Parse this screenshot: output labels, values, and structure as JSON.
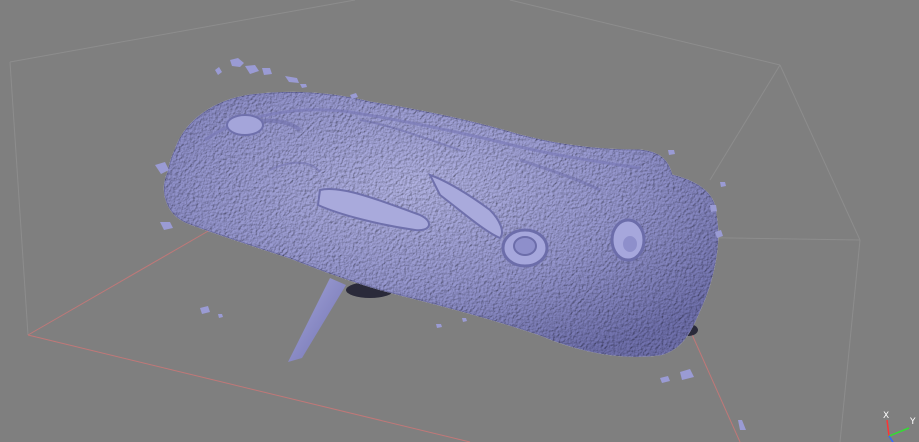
{
  "viewport": {
    "background": "#7f7f7f",
    "mesh_color": "#9a9bd4",
    "bbox_color": "#8a8a8a",
    "bbox_red_color": "#c87070"
  },
  "gizmo": {
    "x_label": "X",
    "y_label": "Y",
    "x_color": "#ff3333",
    "y_color": "#33dd33",
    "z_color": "#3366ff"
  },
  "icons": {
    "mesh": "3d-mesh-icon",
    "gizmo": "axis-gizmo-icon"
  }
}
